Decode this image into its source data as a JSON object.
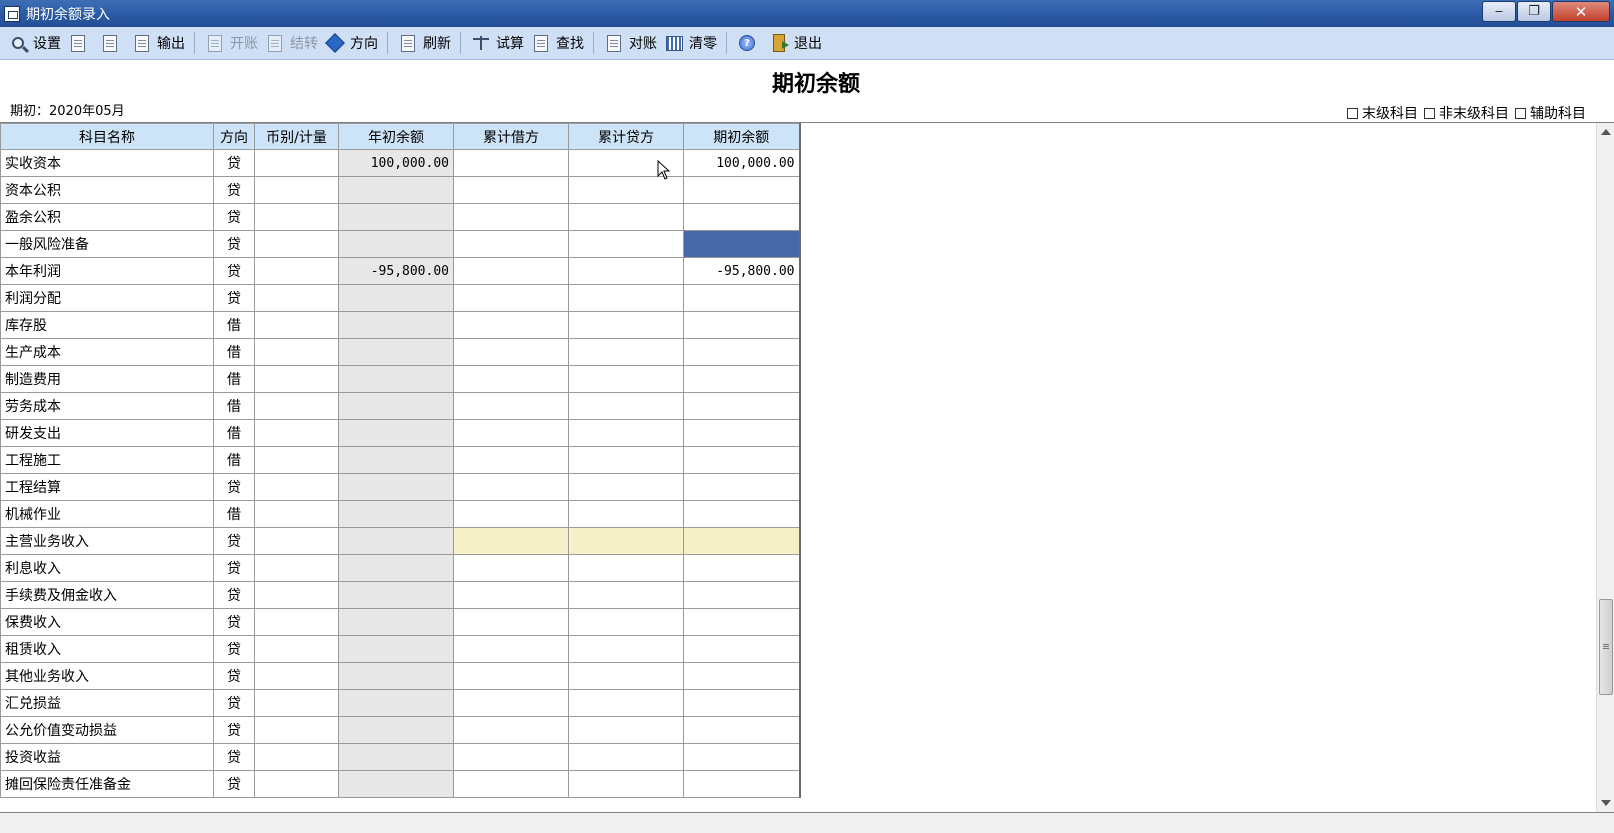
{
  "window": {
    "title": "期初余额录入",
    "minimize": "‒",
    "restore": "❐",
    "close": "✕"
  },
  "toolbar": {
    "items": [
      {
        "label": "设置",
        "icon": "settings-magnifier-icon",
        "disabled": false
      },
      {
        "label": "",
        "icon": "print-icon",
        "disabled": false
      },
      {
        "label": "",
        "icon": "preview-icon",
        "disabled": false
      },
      {
        "label": "输出",
        "icon": "export-icon",
        "disabled": false
      },
      {
        "label": "开账",
        "icon": "open-books-icon",
        "disabled": true
      },
      {
        "label": "结转",
        "icon": "carry-forward-icon",
        "disabled": true
      },
      {
        "label": "方向",
        "icon": "direction-icon",
        "disabled": false
      },
      {
        "label": "刷新",
        "icon": "refresh-icon",
        "disabled": false
      },
      {
        "label": "试算",
        "icon": "trial-balance-icon",
        "disabled": false
      },
      {
        "label": "查找",
        "icon": "find-icon",
        "disabled": false
      },
      {
        "label": "对账",
        "icon": "reconcile-icon",
        "disabled": false
      },
      {
        "label": "清零",
        "icon": "clear-icon",
        "disabled": false
      },
      {
        "label": "",
        "icon": "help-icon",
        "disabled": false
      },
      {
        "label": "退出",
        "icon": "exit-icon",
        "disabled": false
      }
    ]
  },
  "report": {
    "title": "期初余额",
    "period": "期初：2020年05月"
  },
  "legend": [
    "末级科目",
    "非末级科目",
    "辅助科目"
  ],
  "table": {
    "headers": [
      "科目名称",
      "方向",
      "币别/计量",
      "年初余额",
      "累计借方",
      "累计贷方",
      "期初余额"
    ],
    "rows": [
      {
        "name": "实收资本",
        "dir": "贷",
        "currency": "",
        "opening": "100,000.00",
        "debit": "",
        "credit": "",
        "period": "100,000.00",
        "style": ""
      },
      {
        "name": "资本公积",
        "dir": "贷",
        "currency": "",
        "opening": "",
        "debit": "",
        "credit": "",
        "period": "",
        "style": ""
      },
      {
        "name": "盈余公积",
        "dir": "贷",
        "currency": "",
        "opening": "",
        "debit": "",
        "credit": "",
        "period": "",
        "style": ""
      },
      {
        "name": "一般风险准备",
        "dir": "贷",
        "currency": "",
        "opening": "",
        "debit": "",
        "credit": "",
        "period": "",
        "style": "selected"
      },
      {
        "name": "本年利润",
        "dir": "贷",
        "currency": "",
        "opening": "-95,800.00",
        "debit": "",
        "credit": "",
        "period": "-95,800.00",
        "style": ""
      },
      {
        "name": "利润分配",
        "dir": "贷",
        "currency": "",
        "opening": "",
        "debit": "",
        "credit": "",
        "period": "",
        "style": ""
      },
      {
        "name": "库存股",
        "dir": "借",
        "currency": "",
        "opening": "",
        "debit": "",
        "credit": "",
        "period": "",
        "style": ""
      },
      {
        "name": "生产成本",
        "dir": "借",
        "currency": "",
        "opening": "",
        "debit": "",
        "credit": "",
        "period": "",
        "style": ""
      },
      {
        "name": "制造费用",
        "dir": "借",
        "currency": "",
        "opening": "",
        "debit": "",
        "credit": "",
        "period": "",
        "style": ""
      },
      {
        "name": "劳务成本",
        "dir": "借",
        "currency": "",
        "opening": "",
        "debit": "",
        "credit": "",
        "period": "",
        "style": ""
      },
      {
        "name": "研发支出",
        "dir": "借",
        "currency": "",
        "opening": "",
        "debit": "",
        "credit": "",
        "period": "",
        "style": ""
      },
      {
        "name": "工程施工",
        "dir": "借",
        "currency": "",
        "opening": "",
        "debit": "",
        "credit": "",
        "period": "",
        "style": ""
      },
      {
        "name": "工程结算",
        "dir": "贷",
        "currency": "",
        "opening": "",
        "debit": "",
        "credit": "",
        "period": "",
        "style": ""
      },
      {
        "name": "机械作业",
        "dir": "借",
        "currency": "",
        "opening": "",
        "debit": "",
        "credit": "",
        "period": "",
        "style": ""
      },
      {
        "name": "主营业务收入",
        "dir": "贷",
        "currency": "",
        "opening": "",
        "debit": "",
        "credit": "",
        "period": "",
        "style": "yellow"
      },
      {
        "name": "利息收入",
        "dir": "贷",
        "currency": "",
        "opening": "",
        "debit": "",
        "credit": "",
        "period": "",
        "style": ""
      },
      {
        "name": "手续费及佣金收入",
        "dir": "贷",
        "currency": "",
        "opening": "",
        "debit": "",
        "credit": "",
        "period": "",
        "style": ""
      },
      {
        "name": "保费收入",
        "dir": "贷",
        "currency": "",
        "opening": "",
        "debit": "",
        "credit": "",
        "period": "",
        "style": ""
      },
      {
        "name": "租赁收入",
        "dir": "贷",
        "currency": "",
        "opening": "",
        "debit": "",
        "credit": "",
        "period": "",
        "style": ""
      },
      {
        "name": "其他业务收入",
        "dir": "贷",
        "currency": "",
        "opening": "",
        "debit": "",
        "credit": "",
        "period": "",
        "style": ""
      },
      {
        "name": "汇兑损益",
        "dir": "贷",
        "currency": "",
        "opening": "",
        "debit": "",
        "credit": "",
        "period": "",
        "style": ""
      },
      {
        "name": "公允价值变动损益",
        "dir": "贷",
        "currency": "",
        "opening": "",
        "debit": "",
        "credit": "",
        "period": "",
        "style": ""
      },
      {
        "name": "投资收益",
        "dir": "贷",
        "currency": "",
        "opening": "",
        "debit": "",
        "credit": "",
        "period": "",
        "style": ""
      },
      {
        "name": "摊回保险责任准备金",
        "dir": "贷",
        "currency": "",
        "opening": "",
        "debit": "",
        "credit": "",
        "period": "",
        "style": ""
      }
    ]
  },
  "colors": {
    "titlebar": "#2a5aa5",
    "toolbar": "#cfe0f6",
    "header": "#cde3f7",
    "selected": "#4767a6",
    "highlight_row": "#f5f0c8",
    "readonly": "#e8e8e8"
  }
}
